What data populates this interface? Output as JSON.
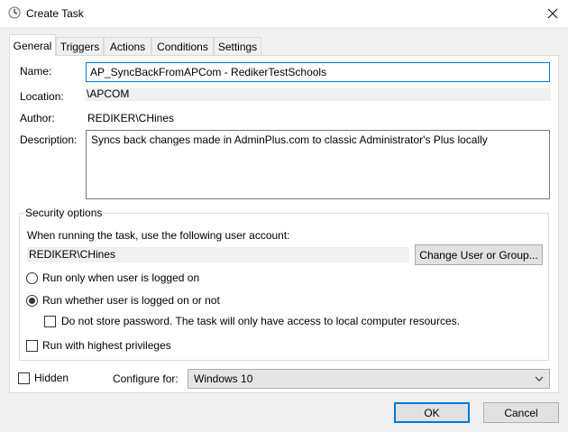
{
  "window": {
    "title": "Create Task",
    "close_glyph": "✕"
  },
  "tabs": [
    {
      "label": "General",
      "active": true
    },
    {
      "label": "Triggers",
      "active": false
    },
    {
      "label": "Actions",
      "active": false
    },
    {
      "label": "Conditions",
      "active": false
    },
    {
      "label": "Settings",
      "active": false
    }
  ],
  "general": {
    "name_label": "Name:",
    "name_value": "AP_SyncBackFromAPCom - RedikerTestSchools",
    "location_label": "Location:",
    "location_value": "\\APCOM",
    "author_label": "Author:",
    "author_value": "REDIKER\\CHines",
    "description_label": "Description:",
    "description_value": "Syncs back changes made in AdminPlus.com to classic Administrator's Plus locally"
  },
  "security": {
    "legend": "Security options",
    "account_prompt": "When running the task, use the following user account:",
    "account_value": "REDIKER\\CHines",
    "change_user_label": "Change User or Group...",
    "radio_logged_on_label": "Run only when user is logged on",
    "radio_logged_on_selected": false,
    "radio_whether_label": "Run whether user is logged on or not",
    "radio_whether_selected": true,
    "no_store_password_label": "Do not store password.  The task will only have access to local computer resources.",
    "no_store_password_checked": false,
    "highest_privileges_label": "Run with highest privileges",
    "highest_privileges_checked": false
  },
  "bottom": {
    "hidden_label": "Hidden",
    "hidden_checked": false,
    "configure_label": "Configure for:",
    "configure_value": "Windows 10"
  },
  "buttons": {
    "ok_label": "OK",
    "cancel_label": "Cancel"
  },
  "colors": {
    "accent": "#0078d7",
    "dialog_bg": "#f0f0f0",
    "button_bg": "#e1e1e1"
  },
  "icons": {
    "app": "clock-icon",
    "close": "close-icon",
    "dropdown": "chevron-down-icon"
  }
}
